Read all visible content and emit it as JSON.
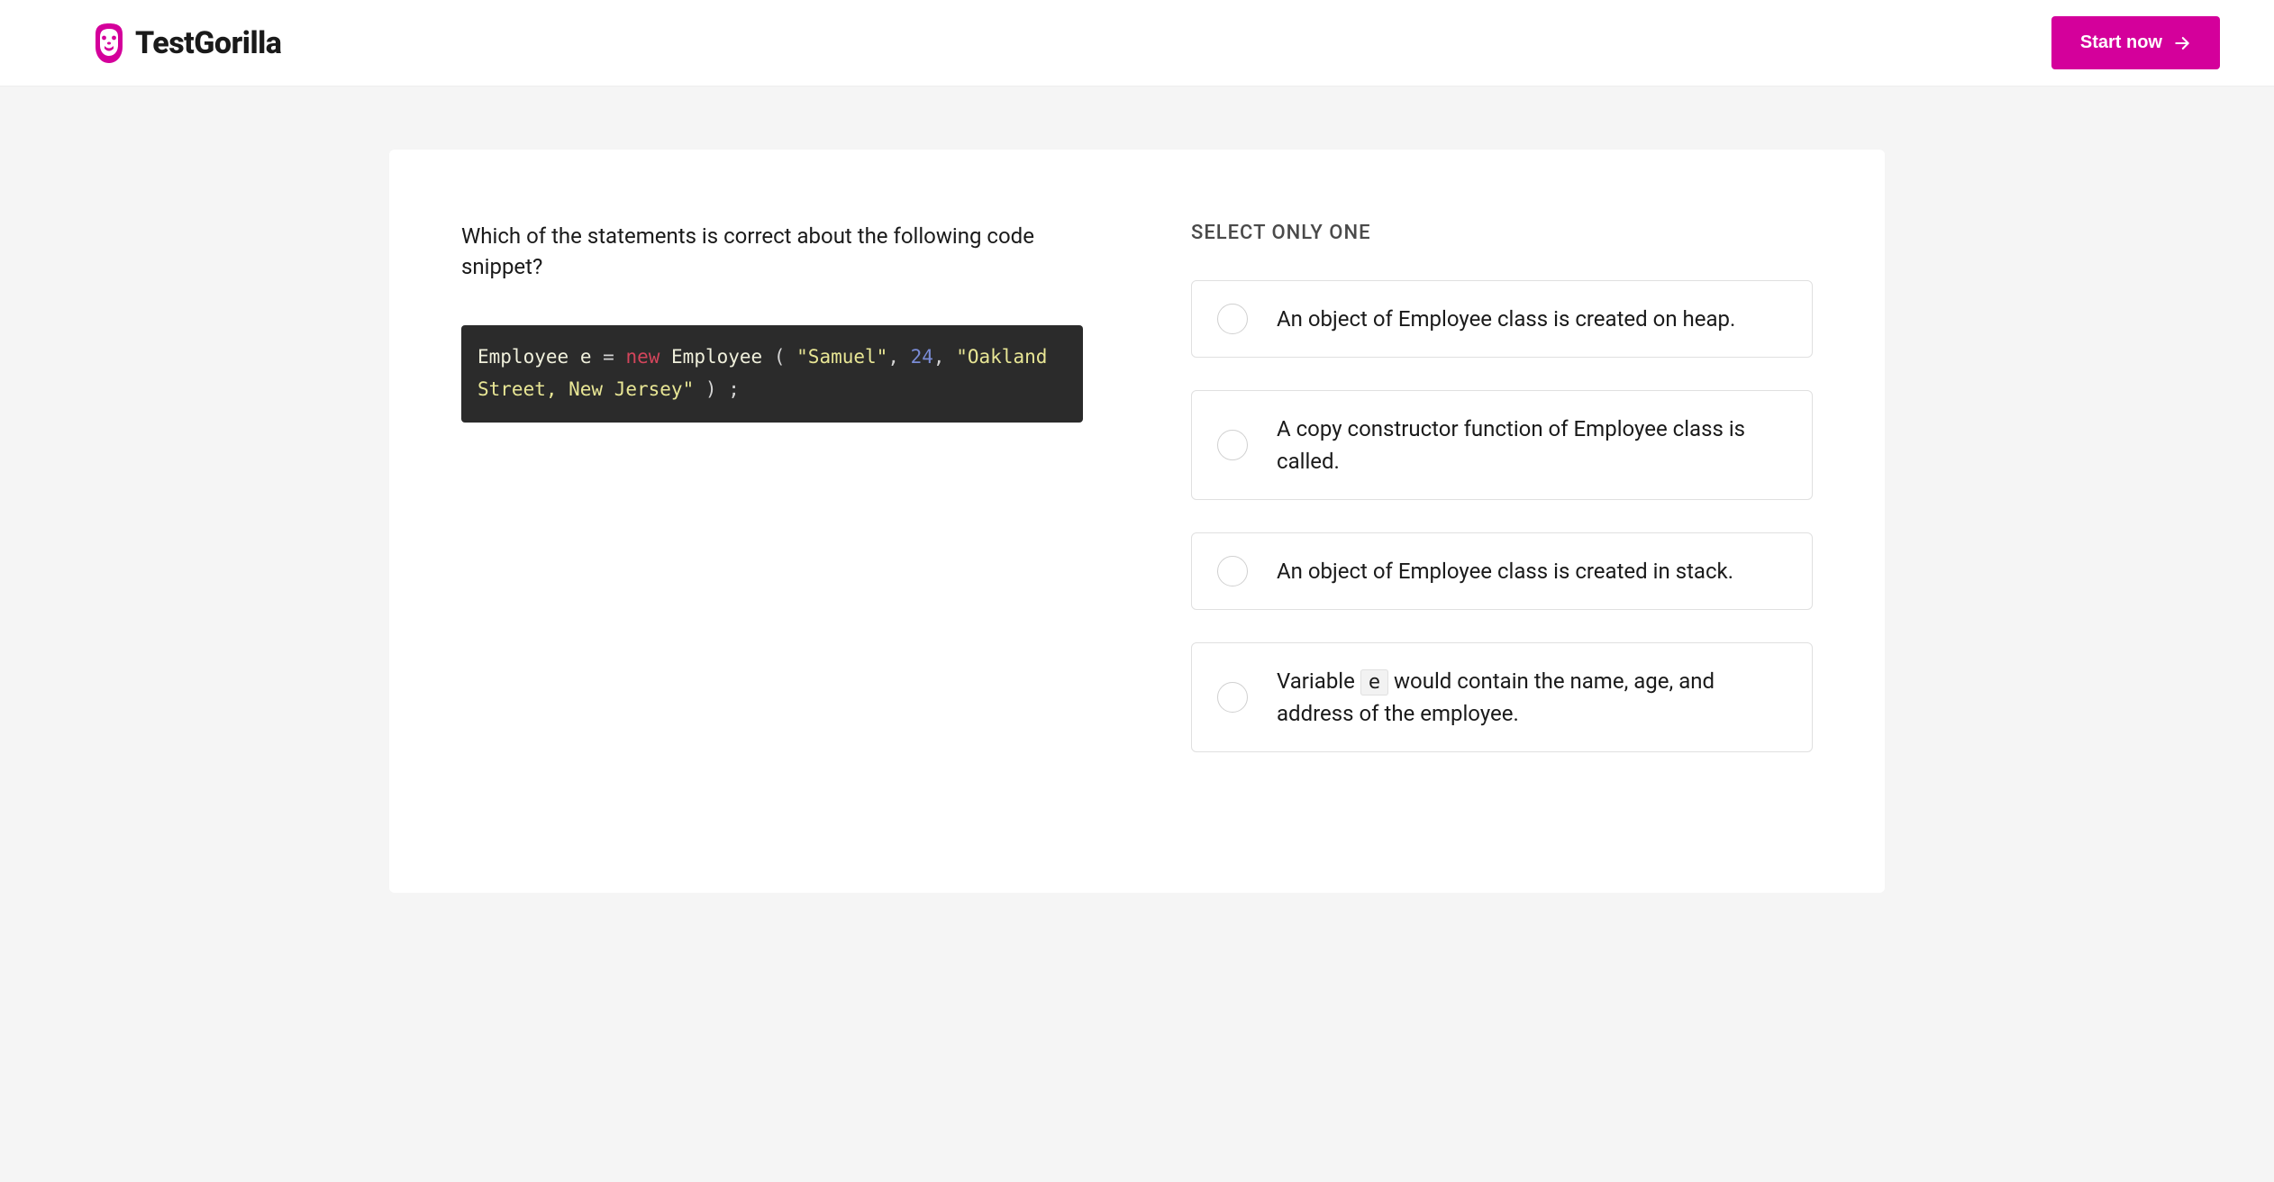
{
  "header": {
    "brand": "TestGorilla",
    "cta_label": "Start now"
  },
  "question": {
    "prompt": "Which of the statements is correct about the following code snippet?",
    "code": {
      "tokens": [
        {
          "t": "type",
          "v": "Employee"
        },
        {
          "t": "sp",
          "v": " "
        },
        {
          "t": "var",
          "v": "e"
        },
        {
          "t": "sp",
          "v": " "
        },
        {
          "t": "op",
          "v": "="
        },
        {
          "t": "sp",
          "v": " "
        },
        {
          "t": "kw",
          "v": "new"
        },
        {
          "t": "sp",
          "v": " "
        },
        {
          "t": "type",
          "v": "Employee"
        },
        {
          "t": "sp",
          "v": " "
        },
        {
          "t": "punct",
          "v": "("
        },
        {
          "t": "sp",
          "v": " "
        },
        {
          "t": "str",
          "v": "\"Samuel\""
        },
        {
          "t": "punct",
          "v": ","
        },
        {
          "t": "sp",
          "v": " "
        },
        {
          "t": "num",
          "v": "24"
        },
        {
          "t": "punct",
          "v": ","
        },
        {
          "t": "sp",
          "v": " "
        },
        {
          "t": "str",
          "v": "\"Oakland Street, New Jersey\""
        },
        {
          "t": "sp",
          "v": " "
        },
        {
          "t": "punct",
          "v": ")"
        },
        {
          "t": "sp",
          "v": " "
        },
        {
          "t": "punct",
          "v": ";"
        }
      ]
    },
    "select_label": "SELECT ONLY ONE",
    "options": [
      {
        "segments": [
          {
            "text": "An object of Employee class is created on heap."
          }
        ]
      },
      {
        "segments": [
          {
            "text": "A copy constructor function of Employee class is called."
          }
        ]
      },
      {
        "segments": [
          {
            "text": "An object of Employee class is created in stack."
          }
        ]
      },
      {
        "segments": [
          {
            "text": "Variable "
          },
          {
            "code": "e"
          },
          {
            "text": " would contain the name, age, and address of the employee."
          }
        ]
      }
    ]
  },
  "colors": {
    "brand_pink": "#d4009b",
    "code_bg": "#2b2b2b"
  }
}
